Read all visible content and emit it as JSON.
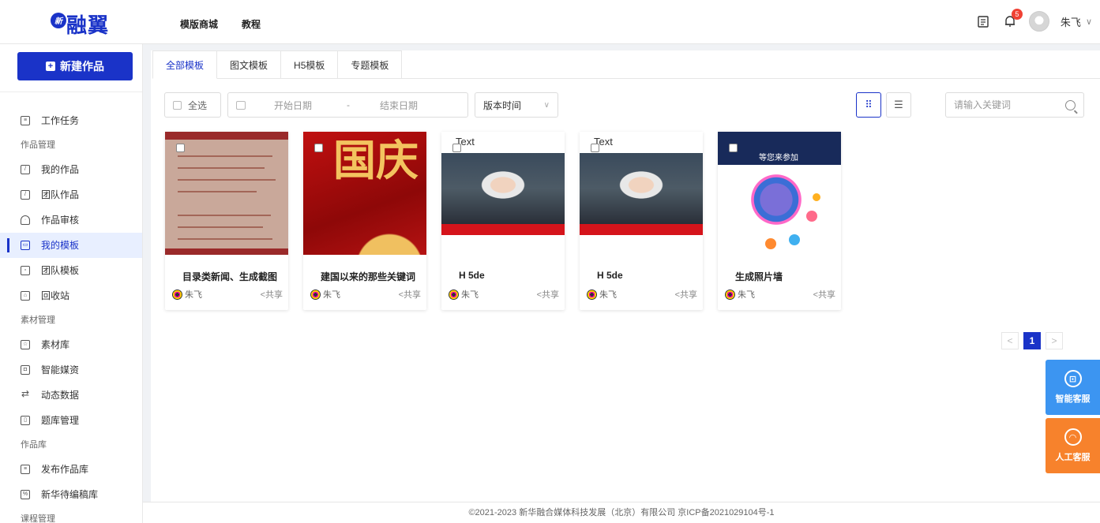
{
  "header": {
    "logo_badge": "新",
    "logo_text": "融翼",
    "nav": [
      {
        "label": "模版商城"
      },
      {
        "label": "教程"
      }
    ],
    "notification_count": "5",
    "username": "朱飞",
    "user_chevron": "∨"
  },
  "sidebar": {
    "new_button_label": "新建作品",
    "items": [
      {
        "type": "item",
        "label": "工作任务",
        "icon": "task-icon"
      },
      {
        "type": "group",
        "label": "作品管理"
      },
      {
        "type": "item",
        "label": "我的作品",
        "icon": "works-icon"
      },
      {
        "type": "item",
        "label": "团队作品",
        "icon": "team-works-icon"
      },
      {
        "type": "item",
        "label": "作品审核",
        "icon": "review-icon"
      },
      {
        "type": "item",
        "label": "我的模板",
        "icon": "template-icon",
        "active": true
      },
      {
        "type": "item",
        "label": "团队模板",
        "icon": "team-template-icon"
      },
      {
        "type": "item",
        "label": "回收站",
        "icon": "recycle-icon"
      },
      {
        "type": "group",
        "label": "素材管理"
      },
      {
        "type": "item",
        "label": "素材库",
        "icon": "material-icon"
      },
      {
        "type": "item",
        "label": "智能媒资",
        "icon": "media-icon"
      },
      {
        "type": "item",
        "label": "动态数据",
        "icon": "refresh-icon"
      },
      {
        "type": "item",
        "label": "题库管理",
        "icon": "question-bank-icon"
      },
      {
        "type": "group",
        "label": "作品库"
      },
      {
        "type": "item",
        "label": "发布作品库",
        "icon": "publish-icon"
      },
      {
        "type": "item",
        "label": "新华待编稿库",
        "icon": "draft-icon"
      },
      {
        "type": "group",
        "label": "课程管理"
      }
    ]
  },
  "tabs": [
    {
      "label": "全部模板",
      "active": true
    },
    {
      "label": "图文模板"
    },
    {
      "label": "H5模板"
    },
    {
      "label": "专题模板"
    }
  ],
  "filters": {
    "select_all": "全选",
    "start_date_placeholder": "开始日期",
    "date_separator": "-",
    "end_date_placeholder": "结束日期",
    "sort_value": "版本时间",
    "search_placeholder": "请输入关键词"
  },
  "cards": [
    {
      "title": "目录类新闻、生成截图",
      "owner": "朱飞",
      "share": "共享",
      "thumb": "t1"
    },
    {
      "title": "建国以来的那些关键词",
      "owner": "朱飞",
      "share": "共享",
      "thumb": "t2",
      "thumb_text": "国庆"
    },
    {
      "title": "H 5de",
      "owner": "朱飞",
      "share": "共享",
      "thumb": "t3",
      "thumb_text": "Text"
    },
    {
      "title": "H 5de",
      "owner": "朱飞",
      "share": "共享",
      "thumb": "t3",
      "thumb_text": "Text"
    },
    {
      "title": "生成照片墙",
      "owner": "朱飞",
      "share": "共享",
      "thumb": "t5",
      "thumb_text": "等您来参加"
    }
  ],
  "pagination": {
    "prev": "<",
    "current": "1",
    "next": ">"
  },
  "footer": "©2021-2023 新华融合媒体科技发展（北京）有限公司 京ICP备2021029104号-1",
  "float": {
    "robot_label": "智能客服",
    "human_label": "人工客服"
  },
  "colors": {
    "primary": "#1a33c8",
    "robot": "#3c95f1",
    "human": "#f7822c",
    "badge": "#f04134"
  }
}
